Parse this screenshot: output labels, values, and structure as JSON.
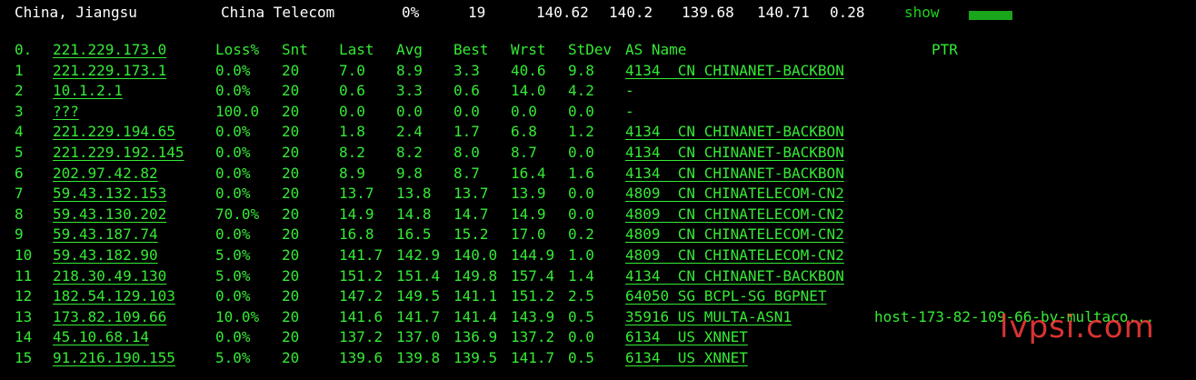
{
  "summary": {
    "location": "China, Jiangsu",
    "isp": "China Telecom",
    "loss": "0%",
    "count": "19",
    "last": "140.62",
    "best": "140.2",
    "avg": "139.68",
    "worst": "140.71",
    "stdev": "0.28",
    "show_label": "show"
  },
  "colors": {
    "background": "#000000",
    "text_green": "#35ea35",
    "header_text": "#ffffff",
    "show_link": "#1fd11f",
    "bar": "#1aa61a",
    "watermark": "#ff3c3c"
  },
  "header": {
    "idx": "0.",
    "host": "221.229.173.0",
    "loss": "Loss%",
    "snt": "Snt",
    "last": "Last",
    "avg": "Avg",
    "best": "Best",
    "wrst": "Wrst",
    "stdev": "StDev",
    "as": "AS Name",
    "ptr": "PTR"
  },
  "hops": [
    {
      "idx": "1",
      "host": "221.229.173.1",
      "loss": "0.0%",
      "snt": "20",
      "last": "7.0",
      "avg": "8.9",
      "best": "3.3",
      "wrst": "40.6",
      "stdev": "9.8",
      "as": "4134  CN CHINANET-BACKBON",
      "ptr": ""
    },
    {
      "idx": "2",
      "host": "10.1.2.1",
      "loss": "0.0%",
      "snt": "20",
      "last": "0.6",
      "avg": "3.3",
      "best": "0.6",
      "wrst": "14.0",
      "stdev": "4.2",
      "as": "-",
      "ptr": ""
    },
    {
      "idx": "3",
      "host": "???",
      "loss": "100.0",
      "snt": "20",
      "last": "0.0",
      "avg": "0.0",
      "best": "0.0",
      "wrst": "0.0",
      "stdev": "0.0",
      "as": "-",
      "ptr": ""
    },
    {
      "idx": "4",
      "host": "221.229.194.65",
      "loss": "0.0%",
      "snt": "20",
      "last": "1.8",
      "avg": "2.4",
      "best": "1.7",
      "wrst": "6.8",
      "stdev": "1.2",
      "as": "4134  CN CHINANET-BACKBON",
      "ptr": ""
    },
    {
      "idx": "5",
      "host": "221.229.192.145",
      "loss": "0.0%",
      "snt": "20",
      "last": "8.2",
      "avg": "8.2",
      "best": "8.0",
      "wrst": "8.7",
      "stdev": "0.0",
      "as": "4134  CN CHINANET-BACKBON",
      "ptr": ""
    },
    {
      "idx": "6",
      "host": "202.97.42.82",
      "loss": "0.0%",
      "snt": "20",
      "last": "8.9",
      "avg": "9.8",
      "best": "8.7",
      "wrst": "16.4",
      "stdev": "1.6",
      "as": "4134  CN CHINANET-BACKBON",
      "ptr": ""
    },
    {
      "idx": "7",
      "host": "59.43.132.153",
      "loss": "0.0%",
      "snt": "20",
      "last": "13.7",
      "avg": "13.8",
      "best": "13.7",
      "wrst": "13.9",
      "stdev": "0.0",
      "as": "4809  CN CHINATELECOM-CN2",
      "ptr": ""
    },
    {
      "idx": "8",
      "host": "59.43.130.202",
      "loss": "70.0%",
      "snt": "20",
      "last": "14.9",
      "avg": "14.8",
      "best": "14.7",
      "wrst": "14.9",
      "stdev": "0.0",
      "as": "4809  CN CHINATELECOM-CN2",
      "ptr": ""
    },
    {
      "idx": "9",
      "host": "59.43.187.74",
      "loss": "0.0%",
      "snt": "20",
      "last": "16.8",
      "avg": "16.5",
      "best": "15.2",
      "wrst": "17.0",
      "stdev": "0.2",
      "as": "4809  CN CHINATELECOM-CN2",
      "ptr": ""
    },
    {
      "idx": "10",
      "host": "59.43.182.90",
      "loss": "5.0%",
      "snt": "20",
      "last": "141.7",
      "avg": "142.9",
      "best": "140.0",
      "wrst": "144.9",
      "stdev": "1.0",
      "as": "4809  CN CHINATELECOM-CN2",
      "ptr": ""
    },
    {
      "idx": "11",
      "host": "218.30.49.130",
      "loss": "5.0%",
      "snt": "20",
      "last": "151.2",
      "avg": "151.4",
      "best": "149.8",
      "wrst": "157.4",
      "stdev": "1.4",
      "as": "4134  CN CHINANET-BACKBON",
      "ptr": ""
    },
    {
      "idx": "12",
      "host": "182.54.129.103",
      "loss": "0.0%",
      "snt": "20",
      "last": "147.2",
      "avg": "149.5",
      "best": "141.1",
      "wrst": "151.2",
      "stdev": "2.5",
      "as": "64050 SG BCPL-SG BGPNET",
      "ptr": ""
    },
    {
      "idx": "13",
      "host": "173.82.109.66",
      "loss": "10.0%",
      "snt": "20",
      "last": "141.6",
      "avg": "141.7",
      "best": "141.4",
      "wrst": "143.9",
      "stdev": "0.5",
      "as": "35916 US MULTA-ASN1",
      "ptr": "host-173-82-109-66-by-multaco..."
    },
    {
      "idx": "14",
      "host": "45.10.68.14",
      "loss": "0.0%",
      "snt": "20",
      "last": "137.2",
      "avg": "137.0",
      "best": "136.9",
      "wrst": "137.2",
      "stdev": "0.0",
      "as": "6134  US XNNET",
      "ptr": ""
    },
    {
      "idx": "15",
      "host": "91.216.190.155",
      "loss": "5.0%",
      "snt": "20",
      "last": "139.6",
      "avg": "139.8",
      "best": "139.5",
      "wrst": "141.7",
      "stdev": "0.5",
      "as": "6134  US XNNET",
      "ptr": ""
    }
  ],
  "watermark": "lvpsi.com"
}
